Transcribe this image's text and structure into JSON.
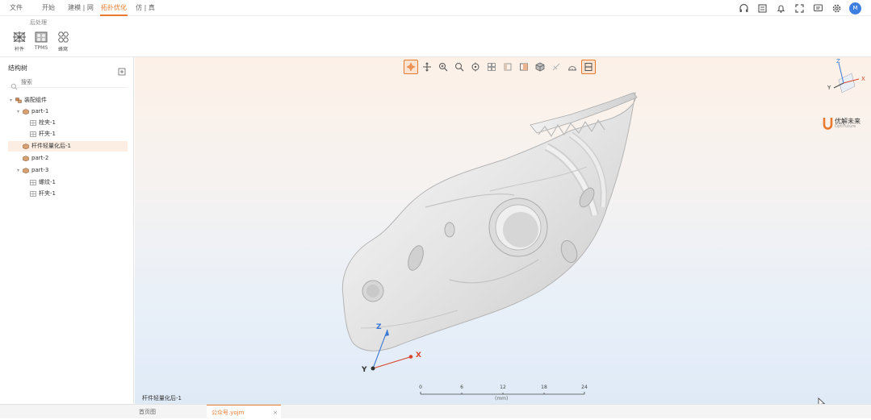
{
  "menu": {
    "items": [
      {
        "label": "文件",
        "active": false
      },
      {
        "label": "开始",
        "active": false
      },
      {
        "label": "建模 | 网",
        "active": false
      },
      {
        "label": "拓扑优化",
        "active": true
      },
      {
        "label": "仿 | 真",
        "active": false
      }
    ]
  },
  "ribbon": {
    "group_title": "后处理",
    "buttons": [
      {
        "label": "杆件",
        "icon": "rod-lattice-icon"
      },
      {
        "label": "TPMS",
        "icon": "tpms-icon"
      },
      {
        "label": "蜂窝",
        "icon": "honeycomb-icon"
      }
    ]
  },
  "top_icons": [
    "headset-icon",
    "list-icon",
    "bell-icon",
    "fullscreen-icon",
    "chat-icon",
    "gear-icon"
  ],
  "avatar_text": "M",
  "left_panel": {
    "title": "结构树",
    "search_placeholder": "搜索",
    "tree": [
      {
        "label": "装配组件",
        "level": 0,
        "expanded": true,
        "icon": "assembly-icon"
      },
      {
        "label": "part-1",
        "level": 1,
        "expanded": true,
        "icon": "part-icon"
      },
      {
        "label": "栓夹-1",
        "level": 2,
        "icon": "feature-icon"
      },
      {
        "label": "杆夹-1",
        "level": 2,
        "icon": "feature-icon"
      },
      {
        "label": "杆件轻量化后-1",
        "level": 1,
        "selected": true,
        "icon": "part-icon"
      },
      {
        "label": "part-2",
        "level": 1,
        "icon": "part-icon"
      },
      {
        "label": "part-3",
        "level": 1,
        "expanded": true,
        "icon": "part-icon"
      },
      {
        "label": "螺纹-1",
        "level": 2,
        "icon": "feature-icon"
      },
      {
        "label": "杆夹-1",
        "level": 2,
        "icon": "feature-icon"
      }
    ]
  },
  "viewport": {
    "toolbar": [
      "select-icon",
      "pan-icon",
      "zoom-in-icon",
      "zoom-fit-icon",
      "rotate-center-icon",
      "view-grid-icon",
      "view-side-icon",
      "view-front-icon",
      "cube-icon",
      "clip-icon",
      "measure-icon",
      "section-icon"
    ],
    "logo_text": "优解未来",
    "logo_sub": "OptiFuture",
    "triad_axes": {
      "x": "X",
      "y": "Y",
      "z": "Z"
    },
    "axis_labels": {
      "x": "X",
      "y": "Y",
      "z": "Z"
    },
    "scale": {
      "ticks": [
        "0",
        "6",
        "12",
        "18",
        "24"
      ],
      "unit": "(mm)"
    },
    "selection_info": "杆件轻量化后-1"
  },
  "bottom_tabs": [
    {
      "label": "首页图",
      "active": false
    },
    {
      "label": "公众号.yojm",
      "active": true
    }
  ],
  "colors": {
    "accent": "#e8792d",
    "axis_x": "#d9442b",
    "axis_y": "#333333",
    "axis_z": "#3b78d6"
  }
}
